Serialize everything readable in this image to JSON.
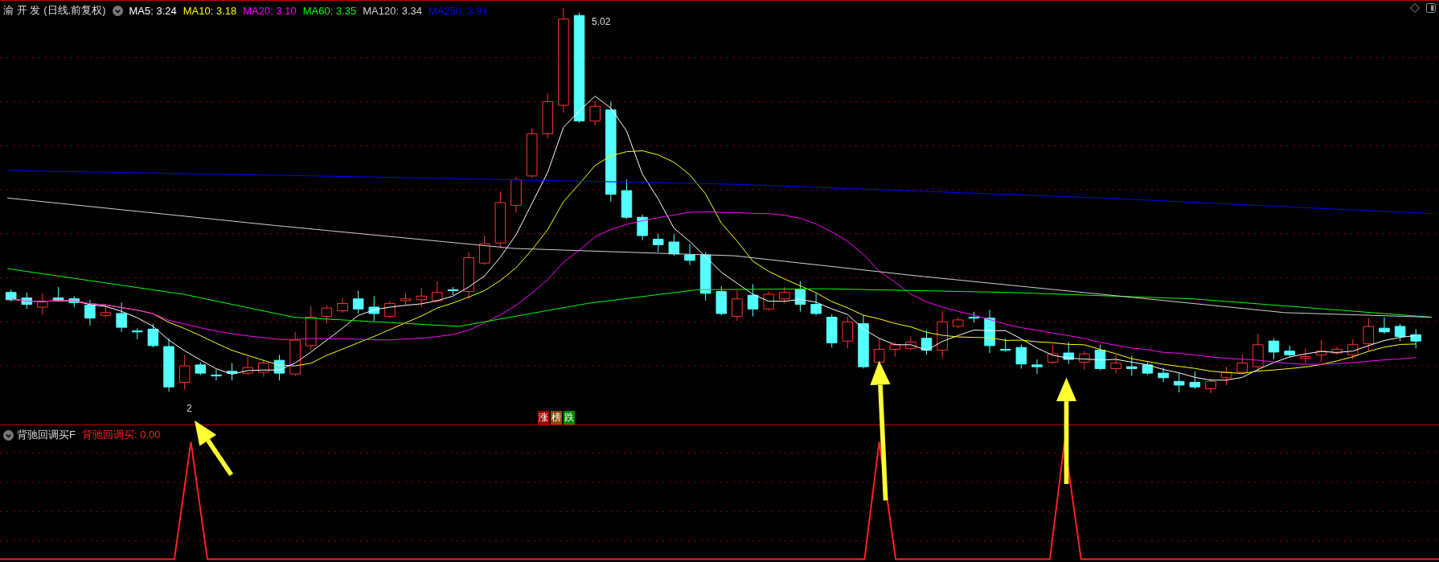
{
  "main_chart": {
    "stock_name": "渝 开 发",
    "mode": "(日线.前复权)",
    "ma_legend": [
      {
        "label": "MA5: 3.24",
        "color": "#ffffff"
      },
      {
        "label": "MA10: 3.18",
        "color": "#ffff00"
      },
      {
        "label": "MA20: 3.10",
        "color": "#ff00ff"
      },
      {
        "label": "MA60: 3.35",
        "color": "#00ff00"
      },
      {
        "label": "MA120: 3.34",
        "color": "#d0d0d0"
      },
      {
        "label": "MA250: 3.91",
        "color": "#0000ff"
      }
    ],
    "high_label": "5.02",
    "low_label": "2",
    "badges": [
      {
        "text": "涨",
        "color": "#a00000"
      },
      {
        "text": "榜",
        "color": "#8a4a00"
      },
      {
        "text": "跌",
        "color": "#008a00"
      }
    ]
  },
  "indicator": {
    "name": "背驰回调买F",
    "value_label": "背驰回调买: 0.00"
  }
}
